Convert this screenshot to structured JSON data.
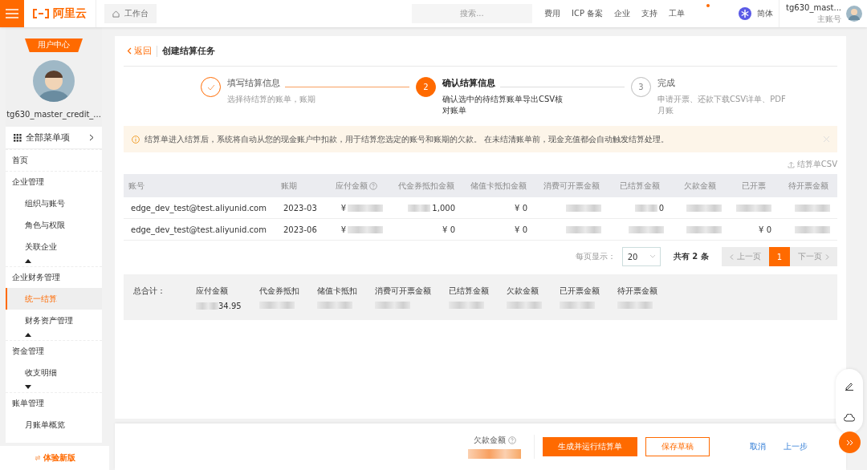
{
  "topbar": {
    "logo": "阿里云",
    "workbench": "工作台",
    "search_placeholder": "搜索...",
    "nav": [
      "费用",
      "ICP 备案",
      "企业",
      "支持",
      "工单"
    ],
    "language": "简体",
    "username": "tg630_mast...",
    "account_type": "主账号"
  },
  "sidebar": {
    "badge": "用户中心",
    "username": "tg630_master_credit_...",
    "all_menu": "全部菜单项",
    "home": "首页",
    "items": [
      {
        "kind": "group",
        "label": "企业管理"
      },
      {
        "kind": "item",
        "label": "组织与账号",
        "selected": false
      },
      {
        "kind": "item",
        "label": "角色与权限",
        "selected": false
      },
      {
        "kind": "item",
        "label": "关联企业",
        "selected": false
      },
      {
        "kind": "caret_up"
      },
      {
        "kind": "group",
        "label": "企业财务管理"
      },
      {
        "kind": "item",
        "label": "统一结算",
        "selected": true
      },
      {
        "kind": "item",
        "label": "财务资产管理",
        "selected": false
      },
      {
        "kind": "caret_up"
      },
      {
        "kind": "group",
        "label": "资金管理"
      },
      {
        "kind": "item",
        "label": "收支明细",
        "selected": false
      },
      {
        "kind": "caret_down"
      },
      {
        "kind": "group",
        "label": "账单管理"
      },
      {
        "kind": "item",
        "label": "月账单概览",
        "selected": false
      }
    ],
    "new_version": "体验新版"
  },
  "header": {
    "back": "返回",
    "title": "创建结算任务"
  },
  "steps": [
    {
      "completed": true,
      "selected": false,
      "title": "填写结算信息",
      "description": "选择待结算的账单，账期"
    },
    {
      "completed": false,
      "selected": true,
      "number": "2",
      "title": "确认结算信息",
      "description": "确认选中的待结算账单导出CSV核对账单"
    },
    {
      "completed": false,
      "selected": false,
      "number": "3",
      "title": "完成",
      "description": "申请开票、还款下载CSV详单、PDF月账"
    }
  ],
  "notice": "结算单进入结算后，系统将自动从您的现金账户中扣款，用于结算您选定的账号和账期的欠款。 在未结清账单前，现金充值都会自动触发结算处理。",
  "export": "结算单CSV",
  "table": {
    "columns": [
      {
        "label": "账号",
        "help": false
      },
      {
        "label": "账期",
        "help": false
      },
      {
        "label": "应付金额",
        "help": true
      },
      {
        "label": "代金券抵扣金额",
        "help": false
      },
      {
        "label": "储值卡抵扣金额",
        "help": false
      },
      {
        "label": "消费可开票金额",
        "help": false
      },
      {
        "label": "已结算金额",
        "help": false
      },
      {
        "label": "欠款金额",
        "help": false
      },
      {
        "label": "已开票",
        "help": false
      },
      {
        "label": "待开票金额",
        "help": false
      }
    ],
    "rows": [
      [
        {
          "kind": "text",
          "text": "edge_dev_test@test.aliyunid.com"
        },
        {
          "kind": "text",
          "text": "2023-03"
        },
        {
          "kind": "blur_after",
          "text": "¥"
        },
        {
          "kind": "blur_before",
          "text": "1,000"
        },
        {
          "kind": "text",
          "text": "¥ 0"
        },
        {
          "kind": "blur"
        },
        {
          "kind": "blur_before",
          "text": "0"
        },
        {
          "kind": "blur"
        },
        {
          "kind": "blur"
        },
        {
          "kind": "blur"
        }
      ],
      [
        {
          "kind": "text",
          "text": "edge_dev_test@test.aliyunid.com"
        },
        {
          "kind": "text",
          "text": "2023-06"
        },
        {
          "kind": "blur_after",
          "text": "¥"
        },
        {
          "kind": "text",
          "text": "¥ 0"
        },
        {
          "kind": "text",
          "text": "¥ 0"
        },
        {
          "kind": "blur"
        },
        {
          "kind": "blur"
        },
        {
          "kind": "blur"
        },
        {
          "kind": "text",
          "text": "¥ 0"
        },
        {
          "kind": "blur"
        }
      ]
    ]
  },
  "pagination": {
    "page_size_label": "每页显示：",
    "page_size": "20",
    "total": "共有 2 条",
    "prev": "上一页",
    "next": "下一页",
    "pages": [
      {
        "label": "1",
        "selected": true
      }
    ]
  },
  "summary": {
    "label": "总合计：",
    "items": [
      {
        "label": "应付金额",
        "value": {
          "kind": "blur_before",
          "text": "34.95"
        }
      },
      {
        "label": "代金券抵扣",
        "value": {
          "kind": "blur"
        }
      },
      {
        "label": "储值卡抵扣",
        "value": {
          "kind": "blur"
        }
      },
      {
        "label": "消费可开票金额",
        "value": {
          "kind": "blur"
        }
      },
      {
        "label": "已结算金额",
        "value": {
          "kind": "blur"
        }
      },
      {
        "label": "欠款金额",
        "value": {
          "kind": "blur"
        }
      },
      {
        "label": "已开票金额",
        "value": {
          "kind": "blur"
        }
      },
      {
        "label": "待开票金额",
        "value": {
          "kind": "blur"
        }
      }
    ]
  },
  "footer": {
    "debt_label": "欠款金额",
    "primary": "生成并运行结算单",
    "draft": "保存草稿",
    "cancel": "取消",
    "prev_step": "上一步"
  }
}
